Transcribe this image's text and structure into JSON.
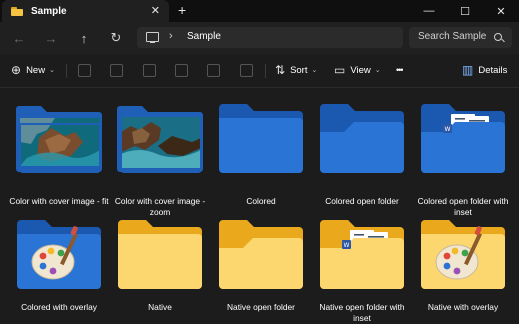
{
  "window": {
    "tab_title": "Sample",
    "tab_close_glyph": "✕",
    "new_tab_glyph": "+",
    "minimize_glyph": "—",
    "maximize_glyph": "☐",
    "close_glyph": "✕"
  },
  "nav": {
    "back_glyph": "←",
    "forward_glyph": "→",
    "up_glyph": "↑",
    "refresh_glyph": "↻",
    "breadcrumb_separator": "›",
    "breadcrumb": "Sample",
    "search_placeholder": "Search Sample"
  },
  "commandbar": {
    "new_glyph": "⊕",
    "new_label": "New",
    "sort_glyph": "⇅",
    "sort_label": "Sort",
    "view_glyph": "▭",
    "view_label": "View",
    "more_glyph": "•••",
    "details_glyph": "▥",
    "details_label": "Details",
    "caret_glyph": "⌄"
  },
  "items": [
    {
      "label": "Color with cover image - fit"
    },
    {
      "label": "Color with cover image - zoom"
    },
    {
      "label": "Colored"
    },
    {
      "label": "Colored open folder"
    },
    {
      "label": "Colored open folder with inset"
    },
    {
      "label": "Colored with overlay"
    },
    {
      "label": "Native"
    },
    {
      "label": "Native open folder"
    },
    {
      "label": "Native open folder with inset"
    },
    {
      "label": "Native with overlay"
    }
  ],
  "colors": {
    "blue_folder": "#1f5fb8",
    "blue_folder_front": "#2b73d4",
    "yellow_folder": "#f2b929",
    "yellow_folder_front": "#fcd36a"
  }
}
